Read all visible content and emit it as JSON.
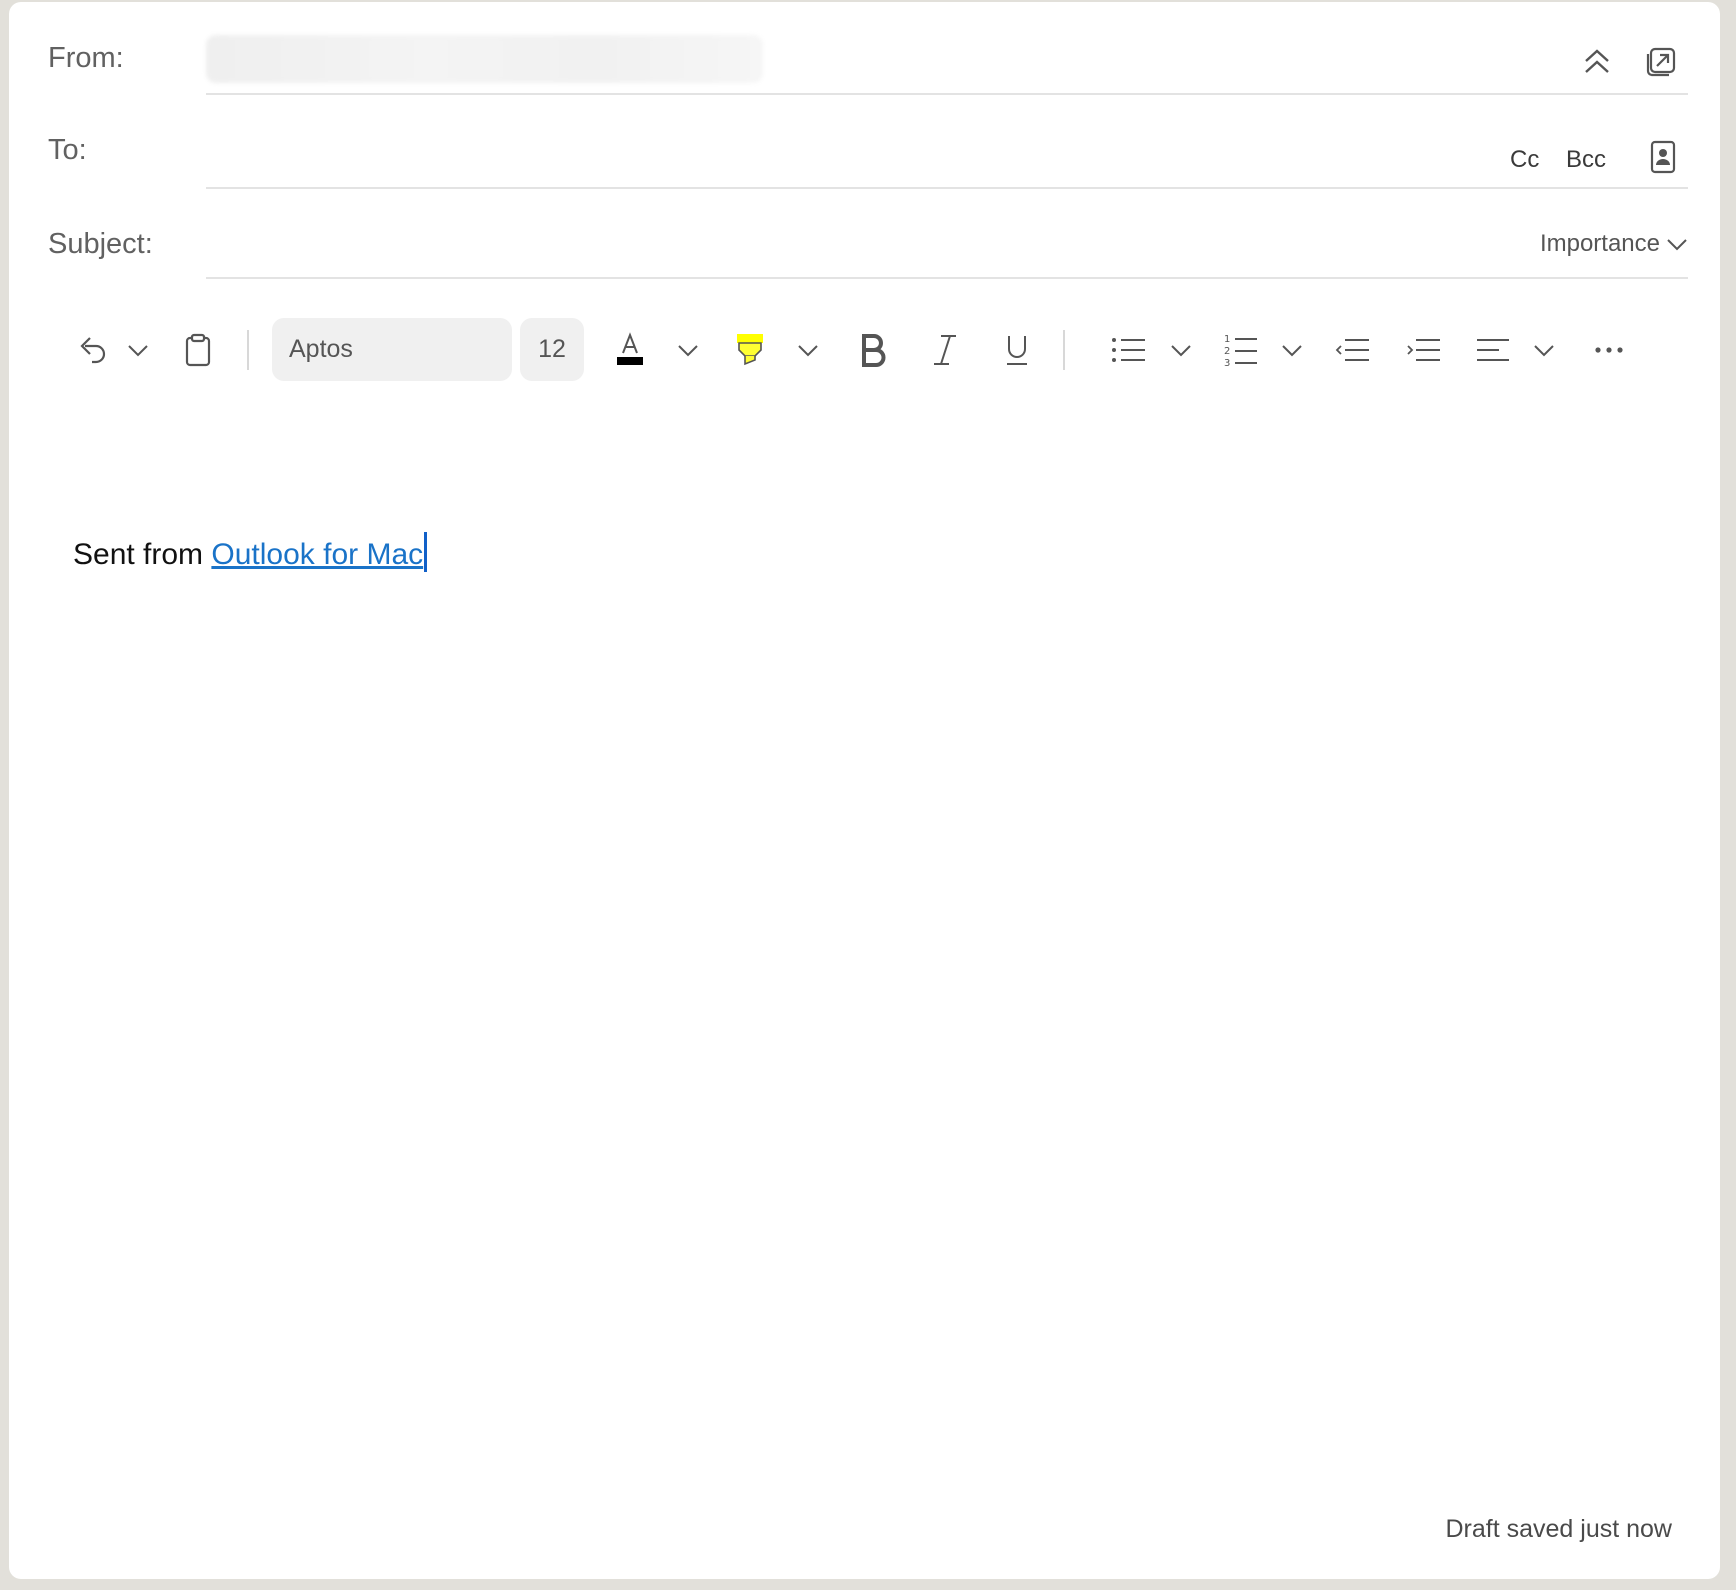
{
  "header": {
    "from_label": "From:",
    "to_label": "To:",
    "subject_label": "Subject:",
    "cc_label": "Cc",
    "bcc_label": "Bcc",
    "importance_label": "Importance",
    "icons": [
      "collapse-up-icon",
      "pop-out-icon",
      "contacts-book-icon",
      "chevron-down-icon"
    ]
  },
  "toolbar": {
    "font_name": "Aptos",
    "font_size": "12",
    "font_color": "#000000",
    "highlight_color": "#ffff00",
    "icons": [
      "undo-icon",
      "clipboard-icon",
      "font-color-icon",
      "highlighter-icon",
      "bold-icon",
      "italic-icon",
      "underline-icon",
      "bullet-list-icon",
      "numbered-list-icon",
      "decrease-indent-icon",
      "increase-indent-icon",
      "align-icon",
      "more-icon"
    ]
  },
  "body": {
    "signature_prefix": "Sent from ",
    "signature_link": "Outlook for Mac"
  },
  "status": {
    "draft_text": "Draft saved just now"
  },
  "colors": {
    "link": "#1a73c8",
    "background": "#e2e0da"
  }
}
